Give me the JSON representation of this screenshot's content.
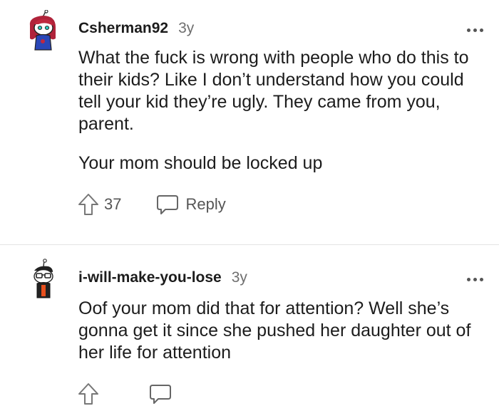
{
  "comments": [
    {
      "username": "Csherman92",
      "age": "3y",
      "paragraphs": [
        "What the fuck is wrong with people who do this to their kids? Like I don’t understand how you could tell your kid they’re ugly. They came from you, parent.",
        "Your mom should be locked up"
      ],
      "upvotes": "37",
      "reply_label": "Reply",
      "avatar_icon": "snoo-avatar-red-hair"
    },
    {
      "username": "i-will-make-you-lose",
      "age": "3y",
      "paragraphs": [
        "Oof your mom did that for attention? Well she’s gonna get it since she pushed her daughter out of her life for attention"
      ],
      "avatar_icon": "snoo-avatar-glasses"
    }
  ],
  "colors": {
    "text": "#1c1c1c",
    "muted": "#6f6f6f",
    "divider": "#e4e4e4"
  }
}
